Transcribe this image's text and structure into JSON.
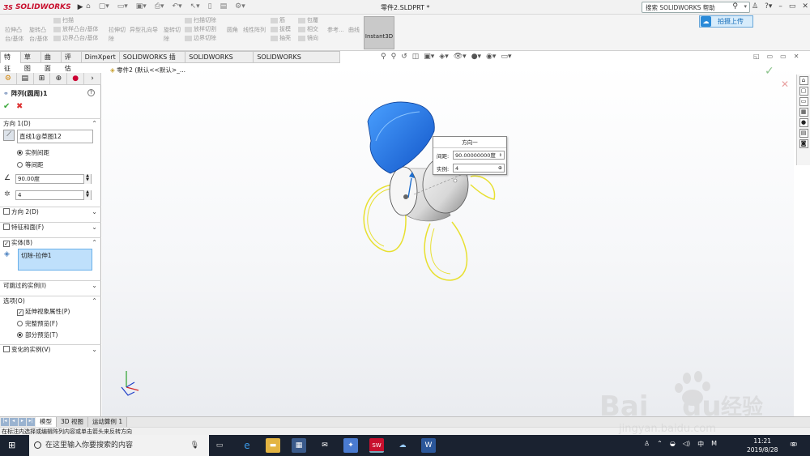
{
  "app": {
    "name": "SOLIDWORKS",
    "doc_title": "零件2.SLDPRT *",
    "search_placeholder": "搜索 SOLIDWORKS 帮助"
  },
  "ribbon": {
    "groups": [
      {
        "lines": [
          "拉伸凸",
          "台/基体"
        ]
      },
      {
        "lines": [
          "旋转凸",
          "台/基体"
        ]
      },
      {
        "lines": [
          "扫描",
          "放样凸台/基体",
          "边界凸台/基体"
        ]
      },
      {
        "lines": [
          "拉伸切",
          "除"
        ]
      },
      {
        "lines": [
          "异型孔向导"
        ]
      },
      {
        "lines": [
          "旋转切",
          "除"
        ]
      },
      {
        "lines": [
          "扫描切除",
          "放样切割",
          "边界切除"
        ]
      },
      {
        "lines": [
          "圆角"
        ]
      },
      {
        "lines": [
          "线性阵列"
        ]
      },
      {
        "lines": [
          "筋",
          "拔模",
          "抽壳"
        ]
      },
      {
        "lines": [
          "包覆",
          "相交",
          "镜向"
        ]
      },
      {
        "lines": [
          "参考..."
        ]
      },
      {
        "lines": [
          "曲线"
        ]
      }
    ],
    "instant3d": "Instant3D",
    "upload": "拍摄上传"
  },
  "tabs": [
    "特征",
    "草图",
    "曲面",
    "评估",
    "DimXpert",
    "SOLIDWORKS 插件",
    "SOLIDWORKS MBD",
    "SOLIDWORKS Inspection"
  ],
  "breadcrumb": "零件2 (默认<<默认>_...",
  "panel": {
    "title": "阵列(圆周)1",
    "dir1": {
      "label": "方向 1(D)",
      "axis": "直线1@草图12",
      "opt_spacing": "实例间距",
      "opt_equal": "等间距",
      "angle": "90.00度",
      "count": "4"
    },
    "dir2": "方向 2(D)",
    "features_faces": "特征和面(F)",
    "bodies": {
      "label": "实体(B)",
      "item": "切除-拉伸1"
    },
    "skip": "可跳过的实例(I)",
    "options": {
      "label": "选项(O)",
      "extend": "延伸视象属性(P)",
      "full": "完整预览(F)",
      "partial": "部分预览(T)"
    },
    "vary": "变化的实例(V)"
  },
  "popup": {
    "title": "方向一",
    "spacing_label": "间距:",
    "spacing_value": "90.00000000度",
    "count_label": "实例:",
    "count_value": "4"
  },
  "bottom_tabs": [
    "模型",
    "3D 视图",
    "运动算例 1"
  ],
  "status": "在标注内选择或编辑阵列内容或单击箭头来反转方向",
  "taskbar": {
    "search": "在这里输入你要搜索的内容",
    "time": "11:21",
    "date": "2019/8/28",
    "ime": "中",
    "notif": "8"
  },
  "watermark": {
    "brand": "Bai",
    "suffix": "du",
    "cn": "经验",
    "url": "jingyan.baidu.com"
  },
  "colors": {
    "accent_blue": "#1f6fcf",
    "preview_yellow": "#e8e030",
    "taskbar": "#1a2230"
  }
}
